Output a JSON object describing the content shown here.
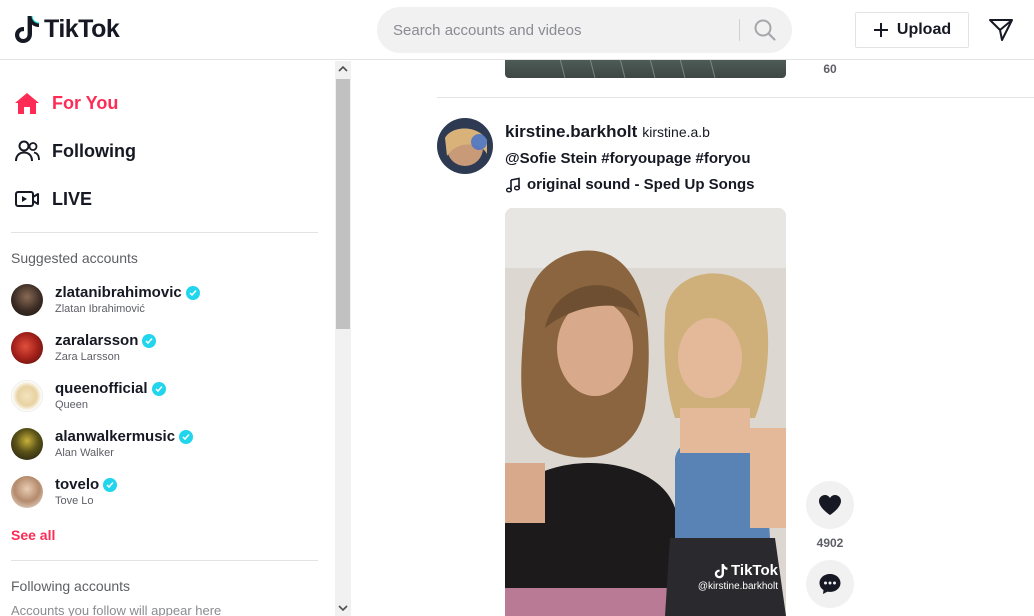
{
  "header": {
    "logo_text": "TikTok",
    "search_placeholder": "Search accounts and videos",
    "upload_label": "Upload"
  },
  "nav": {
    "items": [
      {
        "label": "For You",
        "icon": "home-icon",
        "active": true
      },
      {
        "label": "Following",
        "icon": "people-icon",
        "active": false
      },
      {
        "label": "LIVE",
        "icon": "live-icon",
        "active": false
      }
    ]
  },
  "suggested": {
    "title": "Suggested accounts",
    "accounts": [
      {
        "username": "zlatanibrahimovic",
        "name": "Zlatan Ibrahimović",
        "verified": true
      },
      {
        "username": "zaralarsson",
        "name": "Zara Larsson",
        "verified": true
      },
      {
        "username": "queenofficial",
        "name": "Queen",
        "verified": true
      },
      {
        "username": "alanwalkermusic",
        "name": "Alan Walker",
        "verified": true
      },
      {
        "username": "tovelo",
        "name": "Tove Lo",
        "verified": true
      }
    ],
    "see_all": "See all"
  },
  "following": {
    "title": "Following accounts",
    "empty_text": "Accounts you follow will appear here"
  },
  "feed": {
    "prev_post": {
      "count": "60"
    },
    "post": {
      "username": "kirstine.barkholt",
      "nickname": "kirstine.a.b",
      "caption": "@Sofie Stein #foryoupage #foryou",
      "music": "original sound - Sped Up Songs",
      "watermark_logo": "TikTok",
      "watermark_user": "@kirstine.barkholt",
      "like_count": "4902"
    }
  },
  "colors": {
    "accent": "#fe2c55",
    "verified": "#20d5ec",
    "text": "#161823"
  }
}
